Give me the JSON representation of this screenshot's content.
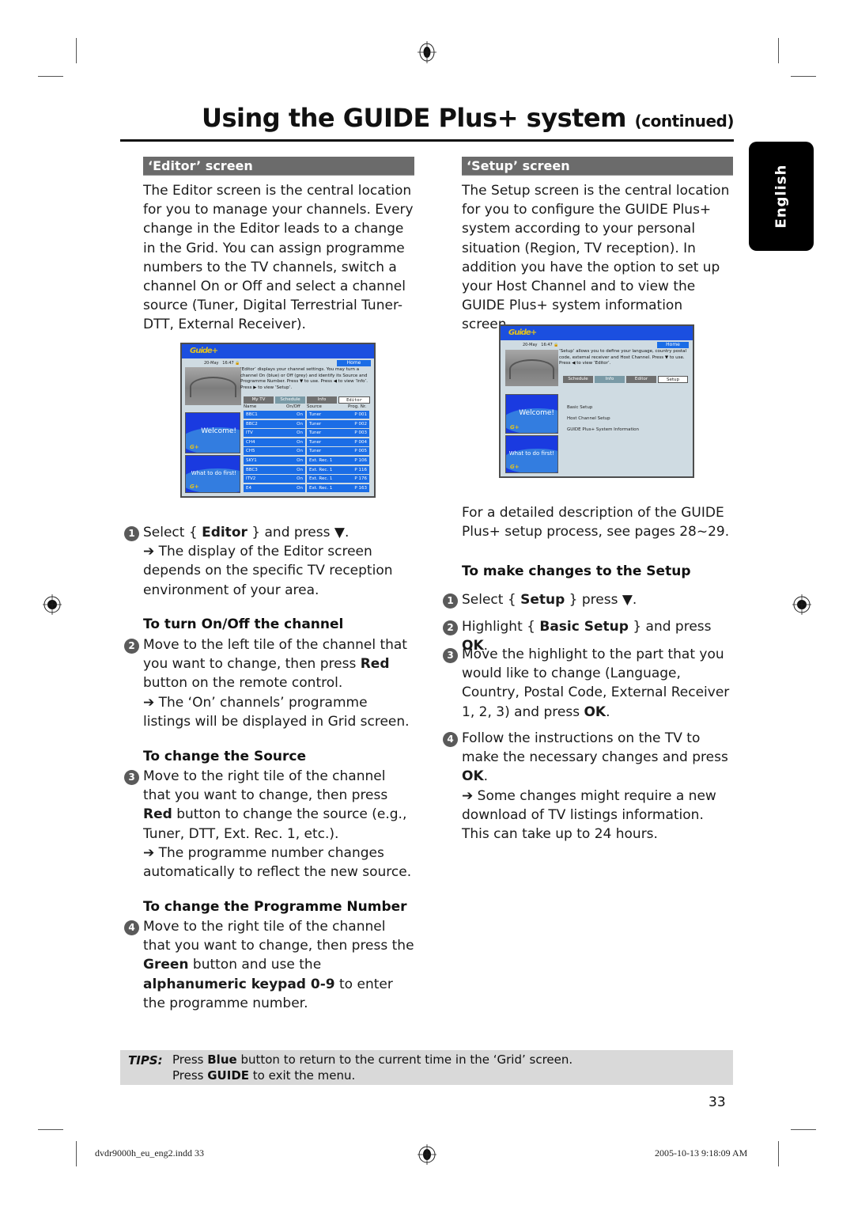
{
  "header": {
    "title": "Using the GUIDE Plus+ system",
    "continued": "(continued)",
    "language_tab": "English"
  },
  "left": {
    "section_title": "‘Editor’ screen",
    "intro": "The Editor screen is the central location for you to manage your channels. Every change in the Editor leads to a change in the Grid. You can assign programme numbers to the TV channels, switch a channel On or Off and select a channel source (Tuner, Digital Terrestrial Tuner-DTT, External Receiver).",
    "tv": {
      "logo": "Guide+",
      "date": "20-May",
      "time": "16:47",
      "home": "Home",
      "description": "‘Editor’ displays your channel settings. You may turn a channel On (blue) or Off (grey) and identify its Source and Programme Number. Press ▼ to use. Press ◀ to view ‘Info’. Press ▶ to view ‘Setup’.",
      "tabs": [
        "My TV",
        "Schedule",
        "Info",
        "Editor"
      ],
      "selected_tab": "Editor",
      "columns": [
        "Name",
        "On/Off",
        "Source",
        "Prog. Nr."
      ],
      "rows": [
        {
          "name": "BBC1",
          "state": "On",
          "source": "Tuner",
          "prog": "P 001"
        },
        {
          "name": "BBC2",
          "state": "On",
          "source": "Tuner",
          "prog": "P 002"
        },
        {
          "name": "ITV",
          "state": "On",
          "source": "Tuner",
          "prog": "P 003"
        },
        {
          "name": "CH4",
          "state": "On",
          "source": "Tuner",
          "prog": "P 004"
        },
        {
          "name": "CH5",
          "state": "On",
          "source": "Tuner",
          "prog": "P 005"
        },
        {
          "name": "SKY1",
          "state": "On",
          "source": "Ext. Rec. 1",
          "prog": "P 106"
        },
        {
          "name": "BBC3",
          "state": "On",
          "source": "Ext. Rec. 1",
          "prog": "P 116"
        },
        {
          "name": "ITV2",
          "state": "On",
          "source": "Ext. Rec. 1",
          "prog": "P 176"
        },
        {
          "name": "E4",
          "state": "On",
          "source": "Ext. Rec. 1",
          "prog": "P 163"
        }
      ],
      "tile_welcome": "Welcome!",
      "tile_first": "What to do first!"
    },
    "step1": {
      "num": "1",
      "pre": "Select { ",
      "bold": "Editor",
      "post": " } and press ▼.",
      "result": "➔ The display of the Editor screen depends on the specific TV reception environment of your area."
    },
    "sub1": "To turn On/Off the channel",
    "step2": {
      "num": "2",
      "pre": "Move to the left tile of the channel that you want to change, then press ",
      "bold": "Red",
      "post": " button on the remote control.",
      "result": "➔ The ‘On’ channels’ programme listings will be displayed in Grid screen."
    },
    "sub2": "To change the Source",
    "step3": {
      "num": "3",
      "pre": "Move to the right tile of the channel that you want to change, then press ",
      "bold": "Red",
      "post": " button to change the source (e.g., Tuner, DTT, Ext. Rec. 1, etc.).",
      "result": "➔ The programme number changes automatically to reflect the new source."
    },
    "sub3": "To change the Programme Number",
    "step4": {
      "num": "4",
      "pre": "Move to the right tile of the channel that you want to change, then press the ",
      "bold": "Green",
      "mid": " button and use the ",
      "bold2": "alphanumeric keypad 0-9",
      "post": " to enter the programme number."
    }
  },
  "right": {
    "section_title": "‘Setup’ screen",
    "intro": "The Setup screen is the central location for you to configure the GUIDE Plus+ system according to your personal situation (Region, TV reception). In addition you have the option to set up your Host Channel and to view the GUIDE Plus+ system information screen.",
    "tv": {
      "logo": "Guide+",
      "date": "20-May",
      "time": "16:47",
      "home": "Home",
      "description": "‘Setup’ allows you to define your language, country postal code, external receiver and Host Channel. Press ▼ to use. Press ◀ to view ‘Editor’.",
      "tabs": [
        "Schedule",
        "Info",
        "Editor",
        "Setup"
      ],
      "selected_tab": "Setup",
      "menu": [
        "Basic Setup",
        "Host Channel Setup",
        "GUIDE Plus+ System Information"
      ],
      "tile_welcome": "Welcome!",
      "tile_first": "What to do first!"
    },
    "detail": "For a detailed description of the GUIDE Plus+ setup process, see pages 28~29.",
    "sub1": "To make changes to the Setup",
    "step1": {
      "num": "1",
      "pre": "Select { ",
      "bold": "Setup",
      "post": " } press ▼."
    },
    "step2": {
      "num": "2",
      "pre": "Highlight { ",
      "bold": "Basic Setup",
      "mid": " } and press ",
      "bold2": "OK",
      "post": "."
    },
    "step3": {
      "num": "3",
      "pre": "Move the highlight to the part that you would like to change (Language, Country, Postal Code, External Receiver 1, 2, 3) and press ",
      "bold": "OK",
      "post": "."
    },
    "step4": {
      "num": "4",
      "pre": "Follow the instructions on the TV to make the necessary changes and press ",
      "bold": "OK",
      "post": ".",
      "result": "➔ Some changes might require a new download of TV listings information. This can take up to 24 hours."
    }
  },
  "tips": {
    "label": "TIPS:",
    "line1_pre": "Press ",
    "line1_bold": "Blue",
    "line1_post": " button to return to the current time in the ‘Grid’ screen.",
    "line2_pre": "Press ",
    "line2_bold": "GUIDE",
    "line2_post": " to exit the menu."
  },
  "page_number": "33",
  "footer": {
    "file": "dvdr9000h_eu_eng2.indd   33",
    "timestamp": "2005-10-13   9:18:09 AM"
  }
}
